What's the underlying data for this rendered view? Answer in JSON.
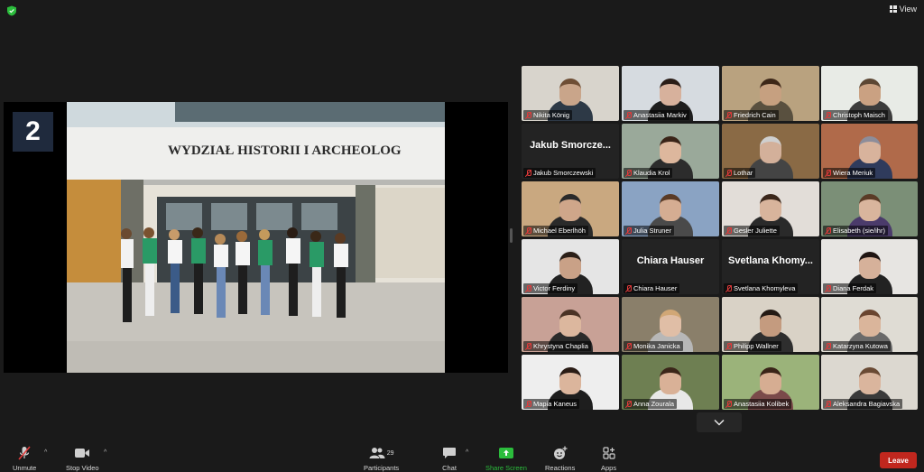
{
  "top": {
    "view_label": "View"
  },
  "share": {
    "slide_number": "2",
    "building_sign": "WYDZIAŁ HISTORII I ARCHEOLOG"
  },
  "participants": [
    {
      "name": "Nikita König",
      "skin": "#c9a58a",
      "hair": "#6e4e35",
      "bg": "#d8d4cc",
      "shirt": "#2d3946"
    },
    {
      "name": "Anastasiia Markiv",
      "skin": "#d7b19c",
      "hair": "#2a1d17",
      "bg": "#d6dbe0",
      "shirt": "#1e1e1e"
    },
    {
      "name": "Friedrich Cain",
      "skin": "#c6a080",
      "hair": "#3d2718",
      "bg": "#b9a27f",
      "shirt": "#59503f"
    },
    {
      "name": "Christoph Maisch",
      "skin": "#caa182",
      "hair": "#5c4734",
      "bg": "#e8ebe6",
      "shirt": "#3c3c3c"
    },
    {
      "name": "Jakub Smorczewski",
      "display": "Jakub  Smorcze...",
      "avatar": true
    },
    {
      "name": "Klaudia Krol",
      "skin": "#ddb79d",
      "hair": "#3a2418",
      "bg": "#9aa99a",
      "shirt": "#2c2c2c"
    },
    {
      "name": "Lothar",
      "skin": "#d3b09a",
      "hair": "#cfcfcf",
      "bg": "#8a6a45",
      "shirt": "#444"
    },
    {
      "name": "Wiera Meriuk",
      "skin": "#d8b39c",
      "hair": "#8d8d9a",
      "bg": "#b06a4a",
      "shirt": "#2f3b5c"
    },
    {
      "name": "Michael Eberlhöh",
      "skin": "#cfa68a",
      "hair": "#2a2a2a",
      "bg": "#c9a880",
      "shirt": "#2a2a2a"
    },
    {
      "name": "Julia Struner",
      "skin": "#d5ad92",
      "hair": "#5a3b26",
      "bg": "#8aa3c3",
      "shirt": "#4a4a4a"
    },
    {
      "name": "Gesler Juliette",
      "skin": "#d8b49c",
      "hair": "#3a261a",
      "bg": "#e2ddd8",
      "shirt": "#2a2a2a"
    },
    {
      "name": "Elisabeth (sie/ihr)",
      "skin": "#d9b59d",
      "hair": "#5a3b26",
      "bg": "#7b8f77",
      "shirt": "#4b3b6b"
    },
    {
      "name": "Victor Ferdiny",
      "skin": "#c9a187",
      "hair": "#2b1f18",
      "bg": "#e5e5e5",
      "shirt": "#222"
    },
    {
      "name": "Chiara Hauser",
      "display": "Chiara Hauser",
      "avatar": true
    },
    {
      "name": "Svetlana Khomyleva",
      "display": "Svetlana  Khomy...",
      "avatar": true
    },
    {
      "name": "Diana Ferdak",
      "skin": "#d6b19a",
      "hair": "#1f1512",
      "bg": "#e7e5e2",
      "shirt": "#222"
    },
    {
      "name": "Khrystyna Chaplia",
      "skin": "#dcb79e",
      "hair": "#4a3325",
      "bg": "#c8a196",
      "shirt": "#2a2a2a",
      "active": true
    },
    {
      "name": "Monika Janicka",
      "skin": "#e0bea6",
      "hair": "#d1a776",
      "bg": "#8a7f6a",
      "shirt": "#b7b7b7"
    },
    {
      "name": "Philipp Wallner",
      "skin": "#c49b7f",
      "hair": "#241a14",
      "bg": "#d9d2c6",
      "shirt": "#2e2e2e"
    },
    {
      "name": "Katarzyna Kutowa",
      "skin": "#dab59b",
      "hair": "#6a4530",
      "bg": "#dfdcd4",
      "shirt": "#6a6a6a"
    },
    {
      "name": "Mapia Kaneus",
      "skin": "#dbb59c",
      "hair": "#2a1c15",
      "bg": "#eeeeee",
      "shirt": "#1e1e1e"
    },
    {
      "name": "Anna Zourala",
      "skin": "#d9b197",
      "hair": "#3b2619",
      "bg": "#6e7f52",
      "shirt": "#e8e8e8"
    },
    {
      "name": "Anastasiia Kolibek",
      "skin": "#d6ad92",
      "hair": "#3a2418",
      "bg": "#9bb37a",
      "shirt": "#7a4a4a"
    },
    {
      "name": "Aleksandra Bagiavska",
      "skin": "#dab59d",
      "hair": "#6a4a34",
      "bg": "#dcd8d0",
      "shirt": "#3a3a3a"
    }
  ],
  "toolbar": {
    "unmute": "Unmute",
    "stop_video": "Stop Video",
    "participants": "Participants",
    "participant_count": "29",
    "chat": "Chat",
    "share_screen": "Share Screen",
    "reactions": "Reactions",
    "apps": "Apps",
    "leave": "Leave"
  },
  "colors": {
    "share_green": "#2bbd3c",
    "leave_red": "#c1271e",
    "active_border": "#c9e86b"
  }
}
